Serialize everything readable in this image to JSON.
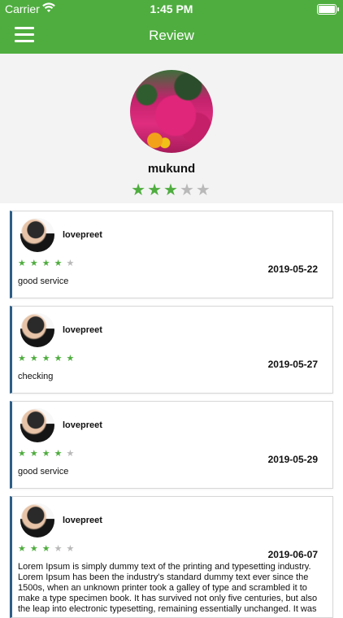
{
  "status_bar": {
    "carrier": "Carrier",
    "time": "1:45 PM"
  },
  "header": {
    "title": "Review",
    "menu_icon": "hamburger-icon",
    "accent": "#4fad3f"
  },
  "profile": {
    "name": "mukund",
    "rating": 3,
    "rating_max": 5
  },
  "reviews": [
    {
      "user": "lovepreet",
      "rating": 4,
      "rating_max": 5,
      "date": "2019-05-22",
      "comment": "good service"
    },
    {
      "user": "lovepreet",
      "rating": 5,
      "rating_max": 5,
      "date": "2019-05-27",
      "comment": "checking"
    },
    {
      "user": "lovepreet",
      "rating": 4,
      "rating_max": 5,
      "date": "2019-05-29",
      "comment": "good service"
    },
    {
      "user": "lovepreet",
      "rating": 3,
      "rating_max": 5,
      "date": "2019-06-07",
      "comment": "Lorem Ipsum is simply dummy text of the printing and typesetting industry. Lorem Ipsum has been the industry's standard dummy text ever since the 1500s, when an unknown printer took a galley of type and scrambled it to make a type specimen book. It has survived not only five centuries, but also the leap into electronic typesetting, remaining essentially unchanged. It was"
    }
  ]
}
